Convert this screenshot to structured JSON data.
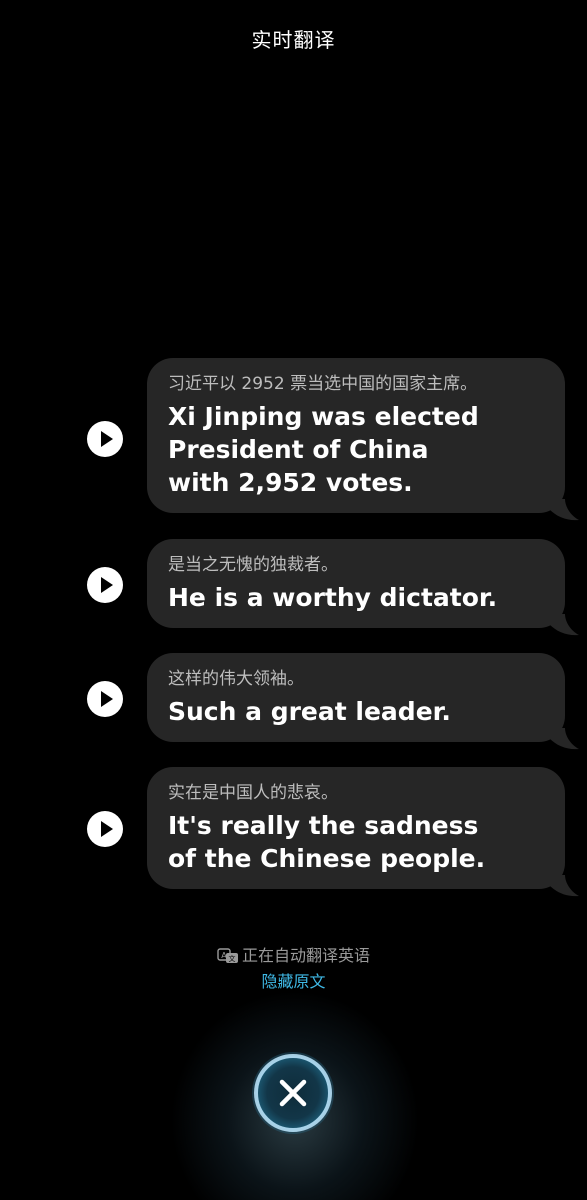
{
  "header": {
    "title": "实时翻译"
  },
  "messages": [
    {
      "source": "习近平以 2952 票当选中国的国家主席。",
      "translation_lines": [
        "Xi Jinping was elected",
        "President of China",
        "with 2,952 votes."
      ]
    },
    {
      "source": "是当之无愧的独裁者。",
      "translation_lines": [
        "He is a worthy dictator."
      ]
    },
    {
      "source": "这样的伟大领袖。",
      "translation_lines": [
        "Such a great leader."
      ]
    },
    {
      "source": "实在是中国人的悲哀。",
      "translation_lines": [
        "It's really the sadness",
        "of the Chinese people."
      ]
    }
  ],
  "footer": {
    "status_text": "正在自动翻译英语",
    "hide_original_label": "隐藏原文"
  },
  "icons": {
    "play": "play-icon",
    "translate": "translate-icon",
    "close": "close-icon"
  },
  "colors": {
    "background": "#000000",
    "bubble": "#262626",
    "link": "#3fb9e6"
  }
}
